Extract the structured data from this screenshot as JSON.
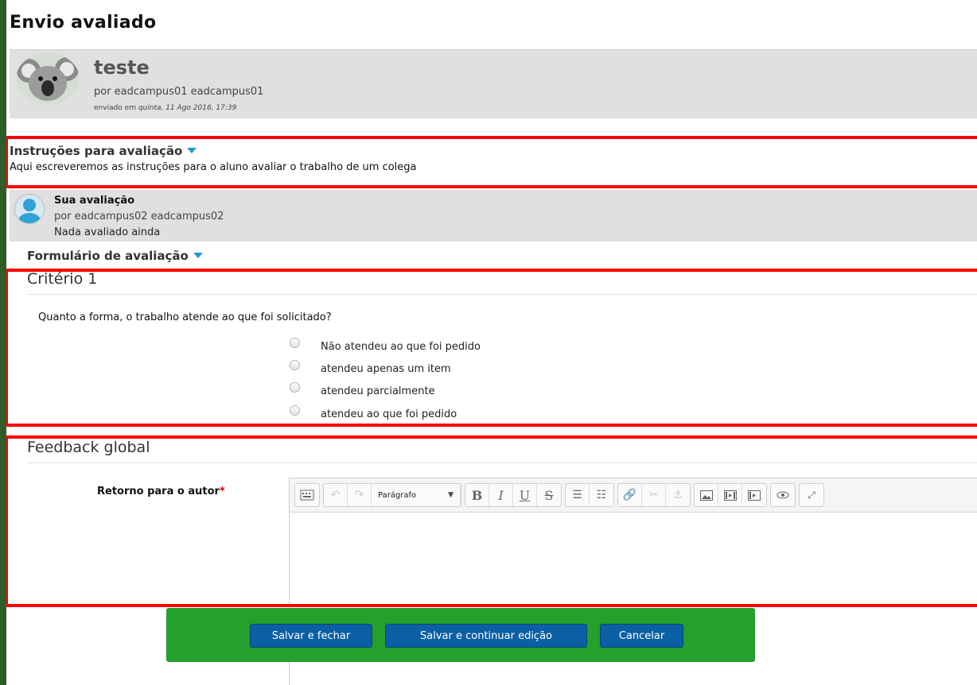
{
  "page_title": "Envio avaliado",
  "submission": {
    "title": "teste",
    "author": "por eadcampus01 eadcampus01",
    "date_prefix": "enviado em",
    "date_value": "quinta, 11 Ago 2016, 17:39"
  },
  "instructions": {
    "title": "Instruções para avaliação",
    "text": "Aqui escreveremos as instruções para o aluno avaliar o trabalho de um colega"
  },
  "my_assessment": {
    "title": "Sua avaliação",
    "author": "por eadcampus02 eadcampus02",
    "status": "Nada avaliado ainda"
  },
  "form": {
    "title": "Formulário de avaliação",
    "criterion": {
      "title": "Critério 1",
      "question": "Quanto a forma, o trabalho atende ao que foi solicitado?",
      "options": [
        "Não atendeu ao que foi pedido",
        "atendeu apenas um item",
        "atendeu parcialmente",
        "atendeu ao que foi pedido"
      ]
    },
    "feedback": {
      "title": "Feedback global",
      "label": "Retorno para o autor",
      "required_mark": "*",
      "editor": {
        "format_value": "Parágrafo",
        "toolbar_icons": [
          "toggle-toolbar-icon",
          "undo-icon",
          "redo-icon",
          "bold-icon",
          "italic-icon",
          "underline-icon",
          "strikethrough-icon",
          "bullet-list-icon",
          "numbered-list-icon",
          "link-icon",
          "unlink-icon",
          "anchor-icon",
          "image-icon",
          "media-icon",
          "video-icon",
          "preview-icon",
          "fullscreen-icon"
        ]
      }
    }
  },
  "actions": {
    "save_close": "Salvar e fechar",
    "save_continue": "Salvar e continuar edição",
    "cancel": "Cancelar"
  },
  "colors": {
    "highlight_border": "#ff0000",
    "action_bar": "#24a02c",
    "button": "#0b5fa5",
    "caret": "#1f9bd0"
  }
}
